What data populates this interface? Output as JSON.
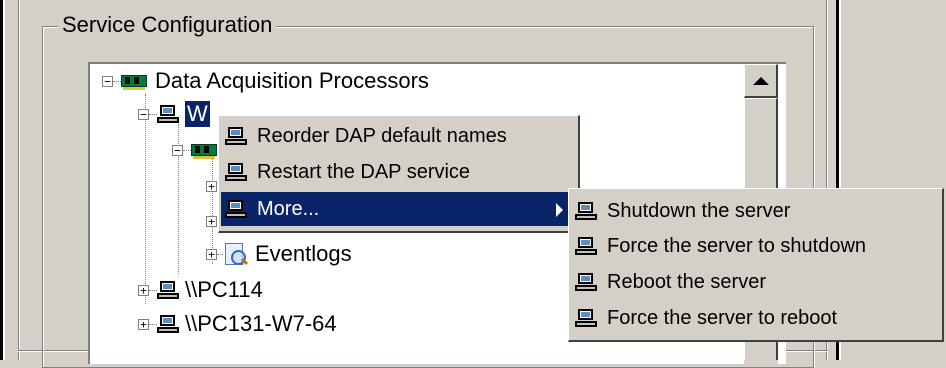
{
  "group": {
    "title": "Service Configuration"
  },
  "tree": {
    "root_label": "Data Acquisition Processors",
    "selected_node_label": "W",
    "eventlogs_label": "Eventlogs",
    "pc114_label": "\\\\PC114",
    "pc131_label": "\\\\PC131-W7-64",
    "expand_minus": "−",
    "expand_plus": "+"
  },
  "context_menu": {
    "items": [
      {
        "label": "Reorder DAP default names"
      },
      {
        "label": "Restart the DAP service"
      },
      {
        "label": "More..."
      }
    ]
  },
  "submenu": {
    "items": [
      {
        "label": "Shutdown the server"
      },
      {
        "label": "Force the server to shutdown"
      },
      {
        "label": "Reboot the server"
      },
      {
        "label": "Force the server to reboot"
      }
    ]
  },
  "colors": {
    "window_bg": "#d4d0c8",
    "highlight_bg": "#0a246a",
    "highlight_text": "#ffffff"
  },
  "icons": [
    "computer-icon",
    "daq-card-icon",
    "eventlog-icon",
    "chevron-right-icon",
    "scroll-up-arrow-icon"
  ]
}
